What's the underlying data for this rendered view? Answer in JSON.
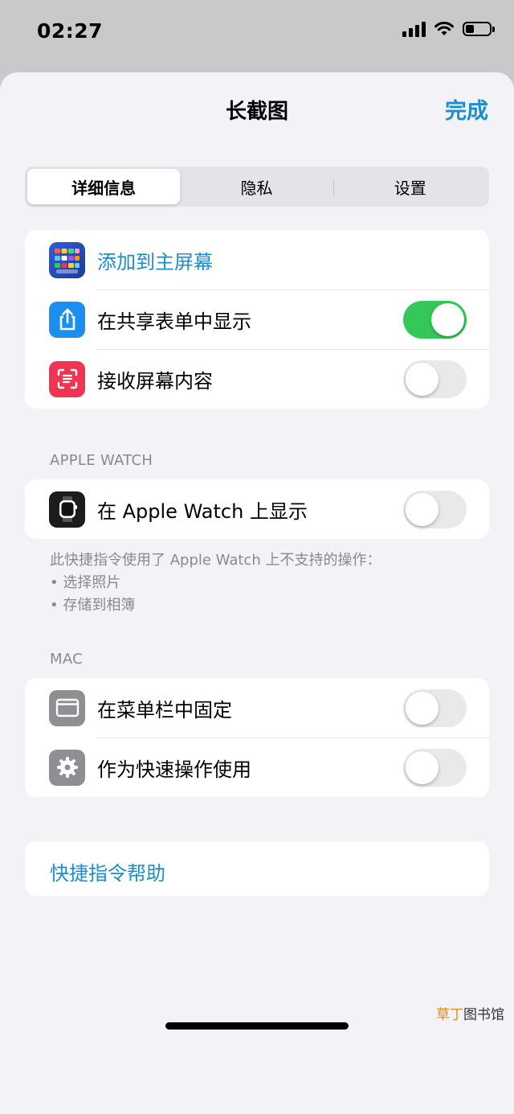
{
  "status_bar": {
    "time": "02:27",
    "icons": [
      "cellular-signal-icon",
      "wifi-icon",
      "battery-icon"
    ],
    "battery_level": 0.35
  },
  "nav": {
    "title": "长截图",
    "done": "完成"
  },
  "tabs": [
    {
      "label": "详细信息",
      "active": true
    },
    {
      "label": "隐私",
      "active": false
    },
    {
      "label": "设置",
      "active": false
    }
  ],
  "details": {
    "add_home": {
      "label": "添加到主屏幕",
      "icon": "home-screen-grid-icon"
    },
    "share_sheet": {
      "label": "在共享表单中显示",
      "icon": "share-icon",
      "icon_color": "#1a8ff0",
      "on": true
    },
    "receive_screen": {
      "label": "接收屏幕内容",
      "icon": "screen-scan-icon",
      "icon_color": "#ee3552",
      "on": false
    }
  },
  "apple_watch": {
    "header": "APPLE WATCH",
    "show": {
      "label": "在 Apple Watch 上显示",
      "icon": "apple-watch-icon",
      "on": false
    },
    "note": "此快捷指令使用了 Apple Watch 上不支持的操作：",
    "unsupported": [
      "• 选择照片",
      "• 存储到相簿"
    ]
  },
  "mac": {
    "header": "MAC",
    "pin_menu": {
      "label": "在菜单栏中固定",
      "icon": "menu-bar-window-icon",
      "on": false
    },
    "quick_action": {
      "label": "作为快速操作使用",
      "icon": "gear-icon",
      "on": false
    }
  },
  "help": {
    "label": "快捷指令帮助"
  },
  "watermark": {
    "part1": "草丁",
    "part2": "图书馆"
  },
  "colors": {
    "accent": "#1a8ed1",
    "toggle_on": "#34c759",
    "background": "#f2f2f7"
  }
}
